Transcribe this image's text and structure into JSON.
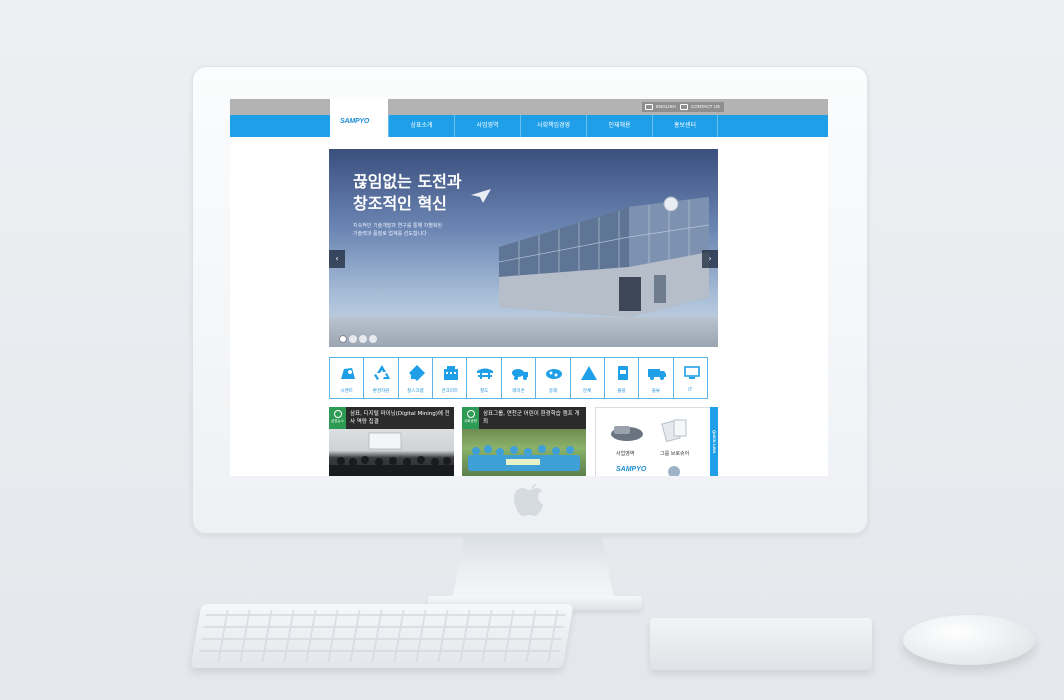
{
  "top_links": {
    "english": "ENGLISH",
    "contact": "CONTACT US"
  },
  "logo": "SAMPYO",
  "nav": [
    "삼표소개",
    "사업영역",
    "사회책임경영",
    "인재채용",
    "홍보센터"
  ],
  "hero": {
    "title_line1": "끊임없는 도전과",
    "title_line2": "창조적인 혁신",
    "subtitle_line1": "지속적인 기술개발과 연구를 통해 차별화된",
    "subtitle_line2": "기술력과 품질로 업계를 선도합니다",
    "prev": "‹",
    "next": "›"
  },
  "categories": [
    {
      "label": "시멘트",
      "icon": "cement-icon"
    },
    {
      "label": "환경자원",
      "icon": "recycle-icon"
    },
    {
      "label": "철스크랩",
      "icon": "scrap-icon"
    },
    {
      "label": "콘크리트",
      "icon": "building-icon"
    },
    {
      "label": "철도",
      "icon": "railway-icon"
    },
    {
      "label": "레미콘",
      "icon": "mixer-truck-icon"
    },
    {
      "label": "골재",
      "icon": "aggregate-icon"
    },
    {
      "label": "분체",
      "icon": "powder-icon"
    },
    {
      "label": "몰탈",
      "icon": "mortar-bag-icon"
    },
    {
      "label": "물류",
      "icon": "logistics-truck-icon"
    },
    {
      "label": "IT",
      "icon": "monitor-icon"
    }
  ],
  "news": [
    {
      "badge": "삼표뉴스",
      "title": "삼표, 디지털 마이닝(Digital Mining)에 전사 역량 집결"
    },
    {
      "badge": "사회공헌",
      "title": "삼표그룹, 연천군 어린이 환경학습 캠프 개최"
    }
  ],
  "quick_link": {
    "tab": "QUICK LINK",
    "item1": "사업영역",
    "item2": "그룹 브로슈어",
    "logo": "SAMPYO"
  },
  "colors": {
    "brand_blue": "#1e9fe8",
    "news_green": "#2e9b54"
  }
}
